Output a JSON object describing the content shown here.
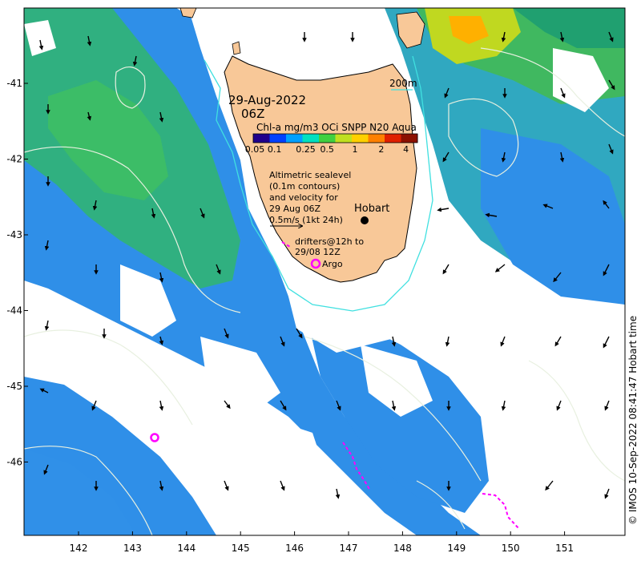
{
  "map": {
    "date": "29-Aug-2022",
    "time": "06Z",
    "scale_label": "200m",
    "colorbar_title": "Chl-a mg/m3 OCi SNPP N20 Aqua",
    "colorbar_ticks": [
      "0.05",
      "0.1",
      "0.25",
      "0.5",
      "1",
      "2",
      "4"
    ],
    "colorbar_colors": [
      "#20008c",
      "#0040ff",
      "#00a0ff",
      "#00e0c0",
      "#40d040",
      "#c0e020",
      "#ffd000",
      "#ff8000",
      "#e02000",
      "#8c1000"
    ],
    "annotation_lines": [
      "Altimetric sealevel",
      "(0.1m contours)",
      "and velocity for",
      "29 Aug 06Z",
      "0.5m/s (1kt 24h)"
    ],
    "city_label": "Hobart",
    "drifters_lines": [
      "drifters@12h to",
      "29/08 12Z"
    ],
    "argo_label": "Argo",
    "x_ticks": [
      "142",
      "143",
      "144",
      "145",
      "146",
      "147",
      "148",
      "149",
      "150",
      "151"
    ],
    "y_ticks": [
      "-41",
      "-42",
      "-43",
      "-44",
      "-45",
      "-46"
    ],
    "copyright": "© IMOS 10-Sep-2022 08:41:47 Hobart time",
    "colors": {
      "land": "#f8c898",
      "contour_200m": "#40e0e0",
      "sealevel_contour": "#e8f0e0",
      "drifter": "#ff00ff",
      "argo": "#ff00ff"
    }
  }
}
